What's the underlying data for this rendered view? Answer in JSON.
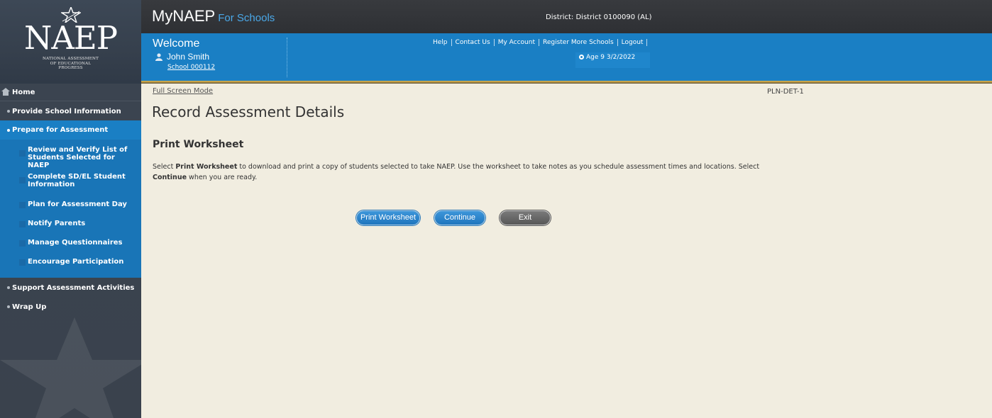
{
  "logo": {
    "acronym": "NAEP",
    "subtitle_lines": [
      "NATIONAL ASSESSMENT",
      "OF EDUCATIONAL",
      "PROGRESS"
    ]
  },
  "topbar": {
    "brand": "MyNAEP",
    "brand_sub": "For Schools",
    "district": "District: District 0100090 (AL)"
  },
  "welcomebar": {
    "welcome": "Welcome",
    "user_name": "John Smith",
    "school": "School 000112",
    "links": [
      "Help",
      "Contact Us",
      "My Account",
      "Register More Schools",
      "Logout"
    ],
    "age_label": "Age 9 3/2/2022"
  },
  "sidebar": {
    "home": "Home",
    "provide": "Provide School Information",
    "prepare": "Prepare for Assessment",
    "sub_items": [
      "Review and Verify List of Students Selected for NAEP",
      "Complete SD/EL Student Information",
      "Plan for Assessment Day",
      "Notify Parents",
      "Manage Questionnaires",
      "Encourage Participation"
    ],
    "support": "Support Assessment Activities",
    "wrap": "Wrap Up"
  },
  "main": {
    "fullscreen": "Full Screen Mode",
    "page_code": "PLN-DET-1",
    "title": "Record Assessment Details",
    "subtitle": "Print Worksheet",
    "desc_part1": "Select ",
    "desc_bold1": "Print Worksheet",
    "desc_part2": " to download and print a copy of students selected to take NAEP. Use the worksheet to take notes as you schedule assessment times and locations. Select ",
    "desc_bold2": "Continue",
    "desc_part3": " when you are ready.",
    "buttons": {
      "print": "Print Worksheet",
      "continue": "Continue",
      "exit": "Exit"
    }
  },
  "colors": {
    "topbar": "#2e3034",
    "welcome_blue": "#1a7fc4",
    "sidebar": "#3a424d",
    "content_bg": "#f1ede0",
    "gold": "#c7a34b"
  }
}
